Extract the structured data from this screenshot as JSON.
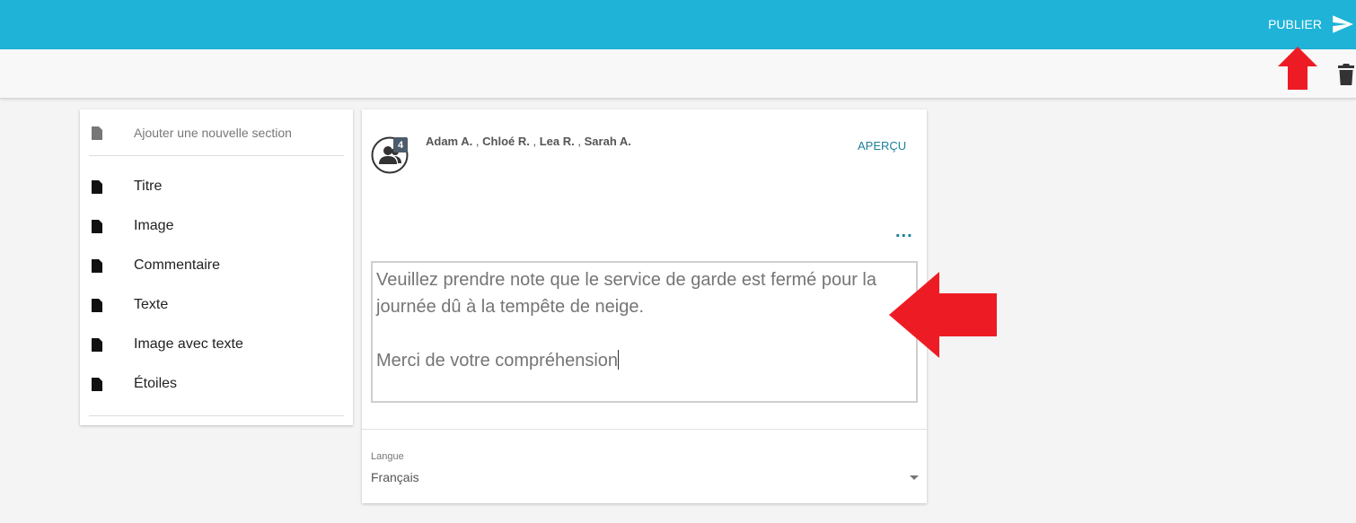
{
  "toolbar": {
    "publish_label": "PUBLIER",
    "publish_icon": "send-icon",
    "delete_icon": "trash-icon",
    "accent_color": "#1fb3d8"
  },
  "sections": {
    "add_label": "Ajouter une nouvelle section",
    "items": [
      {
        "label": "Titre"
      },
      {
        "label": "Image"
      },
      {
        "label": "Commentaire"
      },
      {
        "label": "Texte"
      },
      {
        "label": "Image avec texte"
      },
      {
        "label": "Étoiles"
      }
    ]
  },
  "editor": {
    "recipient_count": "4",
    "recipients": [
      "Adam A.",
      "Chloé R.",
      "Lea R.",
      "Sarah A."
    ],
    "separator": ",",
    "preview_label": "APERÇU",
    "more_label": "...",
    "text_lines": [
      "Veuillez prendre note que le service de garde est fermé pour la",
      "journée dû à la tempête de neige.",
      "",
      "Merci de votre compréhension"
    ],
    "language_label": "Langue",
    "language_value": "Français"
  },
  "annotations": {
    "arrow_color": "#ed1c24"
  }
}
